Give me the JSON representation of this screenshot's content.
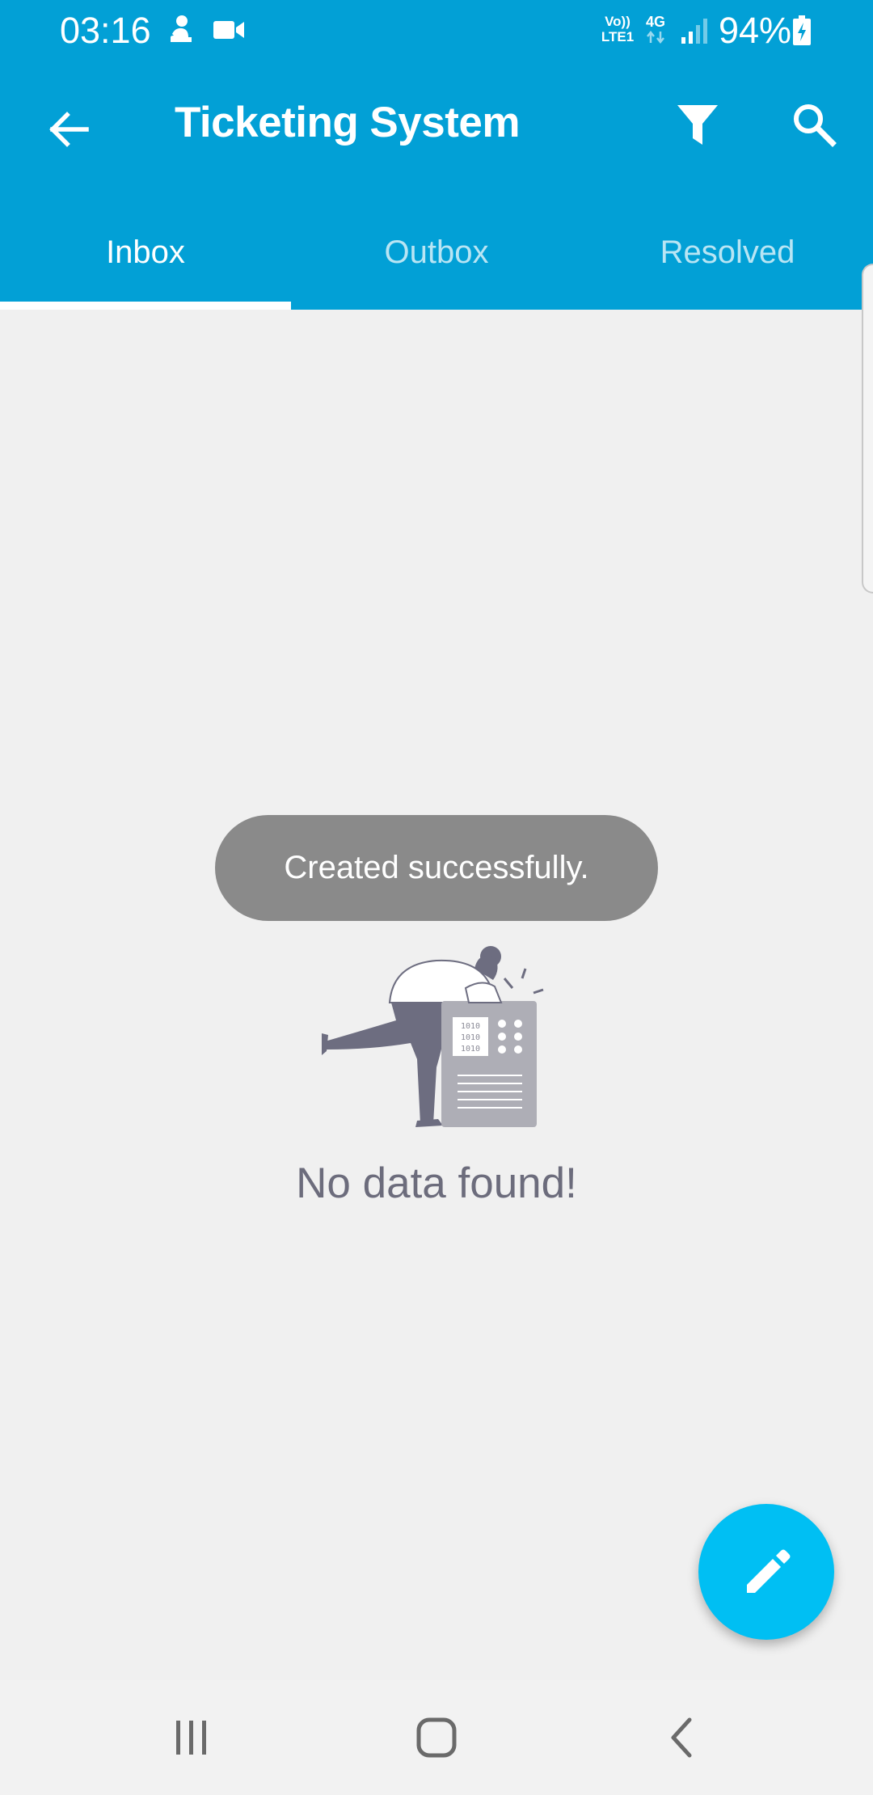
{
  "status_bar": {
    "time": "03:16",
    "network_line1": "Vo))",
    "network_line2": "LTE1",
    "network_type": "4G",
    "battery": "94%",
    "icons": [
      "person-notification-icon",
      "video-camera-icon",
      "signal-icon",
      "battery-charging-icon"
    ]
  },
  "toolbar": {
    "title": "Ticketing System",
    "back_icon": "arrow-back-icon",
    "filter_icon": "filter-icon",
    "search_icon": "search-icon"
  },
  "tabs": [
    {
      "label": "Inbox",
      "active": true
    },
    {
      "label": "Outbox",
      "active": false
    },
    {
      "label": "Resolved",
      "active": false
    }
  ],
  "toast": {
    "message": "Created successfully."
  },
  "empty_state": {
    "message": "No data found!",
    "illustration_code_lines": [
      "1010",
      "1010",
      "1010"
    ]
  },
  "fab": {
    "icon": "pencil-icon"
  },
  "navigation_bar": {
    "recents_icon": "recents-icon",
    "home_icon": "home-icon",
    "back_icon": "nav-back-icon"
  },
  "colors": {
    "primary": "#02a0d6",
    "accent": "#00bff3",
    "background": "#f0f0f0",
    "toast": "#8a8a8a",
    "empty_text": "#6c6c7c"
  }
}
